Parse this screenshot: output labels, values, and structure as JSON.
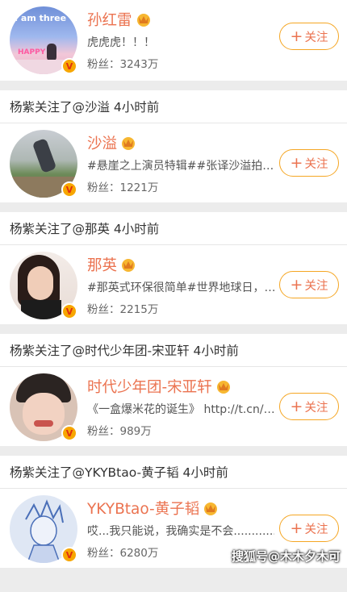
{
  "colors": {
    "name": "#eb7350",
    "button_border": "#f5a623",
    "badge": "#f7a600"
  },
  "follow_label": "关注",
  "fans_prefix": "粉丝：",
  "cards": [
    {
      "name": "孙红雷",
      "desc": "虎虎虎！！！",
      "fans": "3243万",
      "avatar_text": "I am three",
      "avatar_text2": "HAPPY"
    },
    {
      "notice": "杨紫关注了@沙溢 4小时前",
      "name": "沙溢",
      "desc": "#悬崖之上演员特辑##张译沙溢拍…",
      "fans": "1221万"
    },
    {
      "notice": "杨紫关注了@那英 4小时前",
      "name": "那英",
      "desc": "#那英式环保很简单#世界地球日，…",
      "fans": "2215万"
    },
    {
      "notice": "杨紫关注了@时代少年团-宋亚轩 4小时前",
      "name": "时代少年团-宋亚轩",
      "desc": "《一盒爆米花的诞生》 http://t.cn/…",
      "fans": "989万"
    },
    {
      "notice": "杨紫关注了@YKYBtao-黄子韬 4小时前",
      "name": "YKYBtao-黄子韬",
      "desc": "哎...我只能说，我确实是不会..............",
      "fans": "6280万"
    }
  ],
  "watermark": "搜狐号@木木夕木可"
}
